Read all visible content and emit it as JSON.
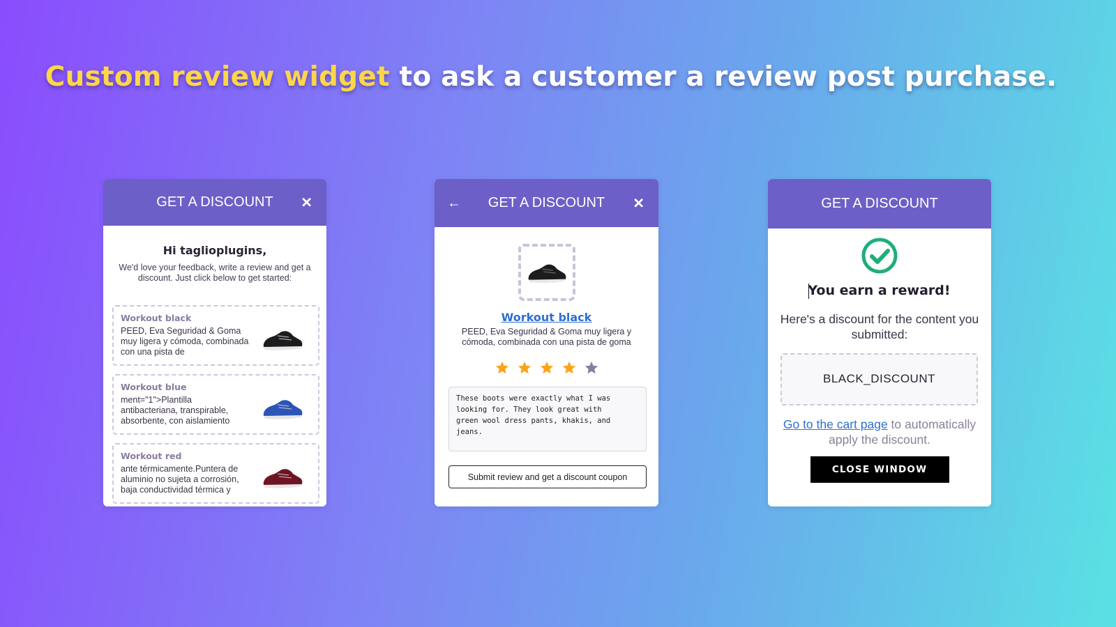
{
  "headline": {
    "highlight": "Custom review widget",
    "rest": " to ask a customer a review post purchase."
  },
  "colors": {
    "highlight": "#ffd54a",
    "header_bg": "#6c5fc7",
    "star_on": "#fba41a",
    "star_off": "#8a7c9e",
    "check_green": "#1fae7a",
    "link": "#2f6fd3"
  },
  "widget1": {
    "title": "GET A DISCOUNT",
    "close_icon": "close-icon",
    "greeting": "Hi taglioplugins,",
    "intro": "We'd love your feedback, write a review and get a discount. Just click below to get started:",
    "products": [
      {
        "name": "Workout black",
        "desc": "PEED, Eva Seguridad & Goma muy ligera y cómoda, combinada con una pista de",
        "color": "black"
      },
      {
        "name": "Workout blue",
        "desc": "ment=\"1\">Plantilla antibacteriana, transpirable, absorbente, con aislamiento",
        "color": "blue"
      },
      {
        "name": "Workout red",
        "desc": "ante térmicamente.Puntera de aluminio no sujeta a corrosión, baja conductividad térmica y",
        "color": "red"
      }
    ]
  },
  "widget2": {
    "title": "GET A DISCOUNT",
    "back_icon": "arrow-left-icon",
    "close_icon": "close-icon",
    "product_name": "Workout black",
    "product_desc": "PEED, Eva Seguridad & Goma muy ligera y cómoda, combinada con una pista de goma",
    "rating": 4,
    "rating_max": 5,
    "review_text": "These boots were exactly what I was\nlooking for. They look great with\ngreen wool dress pants, khakis, and\njeans.",
    "submit_label": "Submit review and get a discount coupon"
  },
  "widget3": {
    "title": "GET A DISCOUNT",
    "check_icon": "check-circle-icon",
    "reward_title": "You earn a reward!",
    "reward_sub": "Here's a discount for the content you submitted:",
    "coupon_code": "BLACK_DISCOUNT",
    "cart_link": "Go to the cart page",
    "cart_rest": " to automatically apply the discount.",
    "close_label": "CLOSE WINDOW"
  }
}
